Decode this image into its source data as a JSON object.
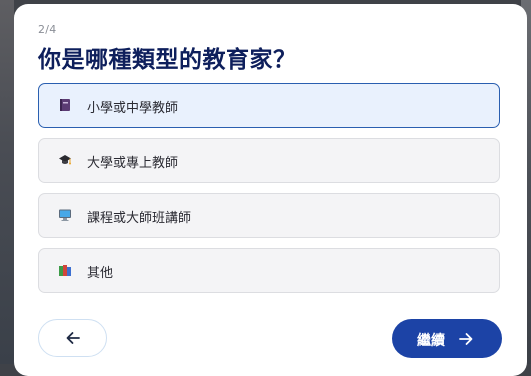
{
  "dialog": {
    "step": "2/4",
    "question": "你是哪種類型的教育家？"
  },
  "options": [
    {
      "label": "小學或中學教師",
      "icon": "notebook-icon",
      "selected": true
    },
    {
      "label": "大學或專上教師",
      "icon": "graduation-cap-icon",
      "selected": false
    },
    {
      "label": "課程或大師班講師",
      "icon": "monitor-icon",
      "selected": false
    },
    {
      "label": "其他",
      "icon": "books-icon",
      "selected": false
    }
  ],
  "nav": {
    "back_icon": "arrow-left-icon",
    "next_label": "繼續",
    "next_icon": "arrow-right-icon"
  },
  "colors": {
    "title": "#0e1f5c",
    "primary_button": "#1c43a6",
    "selected_border": "#2a5fb0",
    "selected_background": "#e9f1fd"
  }
}
